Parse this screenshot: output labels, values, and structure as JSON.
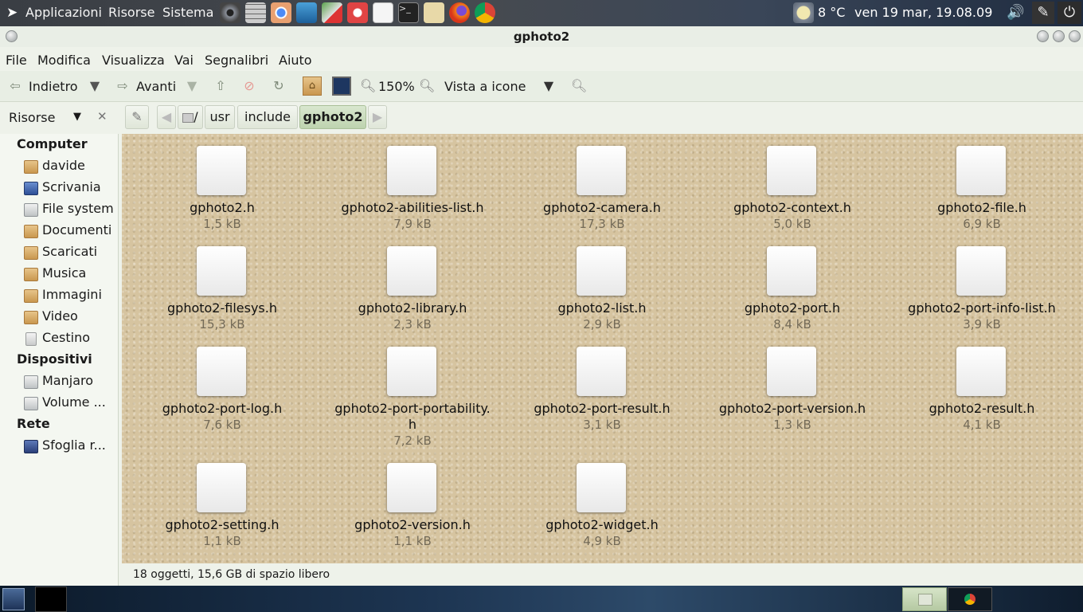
{
  "top_panel": {
    "menus": [
      "Applicazioni",
      "Risorse",
      "Sistema"
    ],
    "launchers": [
      "disc-icon",
      "calculator-icon",
      "chromium-icon",
      "network-icon",
      "maps-icon",
      "media-icon",
      "document-icon",
      "terminal-icon",
      "notes-icon",
      "firefox-icon",
      "chrome-icon"
    ],
    "weather": "8 °C",
    "clock": "ven 19 mar, 19.08.09"
  },
  "window": {
    "title": "gphoto2",
    "menubar": [
      "File",
      "Modifica",
      "Visualizza",
      "Vai",
      "Segnalibri",
      "Aiuto"
    ],
    "toolbar": {
      "back": "Indietro",
      "forward": "Avanti",
      "zoom": "150%",
      "view_mode": "Vista a icone"
    },
    "sidebar_selector": "Risorse",
    "breadcrumbs": [
      "/",
      "usr",
      "include",
      "gphoto2"
    ]
  },
  "sidebar": {
    "computer_header": "Computer",
    "computer": [
      {
        "label": "davide",
        "icon": "folder-icon"
      },
      {
        "label": "Scrivania",
        "icon": "desktop-icon"
      },
      {
        "label": "File system",
        "icon": "drive-icon"
      },
      {
        "label": "Documenti",
        "icon": "folder-icon"
      },
      {
        "label": "Scaricati",
        "icon": "folder-icon"
      },
      {
        "label": "Musica",
        "icon": "folder-icon"
      },
      {
        "label": "Immagini",
        "icon": "folder-icon"
      },
      {
        "label": "Video",
        "icon": "folder-icon"
      },
      {
        "label": "Cestino",
        "icon": "trash-icon"
      }
    ],
    "devices_header": "Dispositivi",
    "devices": [
      {
        "label": "Manjaro",
        "icon": "drive-icon"
      },
      {
        "label": "Volume ...",
        "icon": "drive-icon"
      }
    ],
    "network_header": "Rete",
    "network": [
      {
        "label": "Sfoglia r...",
        "icon": "network-icon"
      }
    ]
  },
  "files": [
    {
      "name": "gphoto2.h",
      "size": "1,5 kB"
    },
    {
      "name": "gphoto2-abilities-list.h",
      "size": "7,9 kB"
    },
    {
      "name": "gphoto2-camera.h",
      "size": "17,3 kB"
    },
    {
      "name": "gphoto2-context.h",
      "size": "5,0 kB"
    },
    {
      "name": "gphoto2-file.h",
      "size": "6,9 kB"
    },
    {
      "name": "gphoto2-filesys.h",
      "size": "15,3 kB"
    },
    {
      "name": "gphoto2-library.h",
      "size": "2,3 kB"
    },
    {
      "name": "gphoto2-list.h",
      "size": "2,9 kB"
    },
    {
      "name": "gphoto2-port.h",
      "size": "8,4 kB"
    },
    {
      "name": "gphoto2-port-info-list.h",
      "size": "3,9 kB"
    },
    {
      "name": "gphoto2-port-log.h",
      "size": "7,6 kB"
    },
    {
      "name": "gphoto2-port-portability.h",
      "size": "7,2 kB"
    },
    {
      "name": "gphoto2-port-result.h",
      "size": "3,1 kB"
    },
    {
      "name": "gphoto2-port-version.h",
      "size": "1,3 kB"
    },
    {
      "name": "gphoto2-result.h",
      "size": "4,1 kB"
    },
    {
      "name": "gphoto2-setting.h",
      "size": "1,1 kB"
    },
    {
      "name": "gphoto2-version.h",
      "size": "1,1 kB"
    },
    {
      "name": "gphoto2-widget.h",
      "size": "4,9 kB"
    }
  ],
  "status": "18 oggetti, 15,6 GB di spazio libero"
}
